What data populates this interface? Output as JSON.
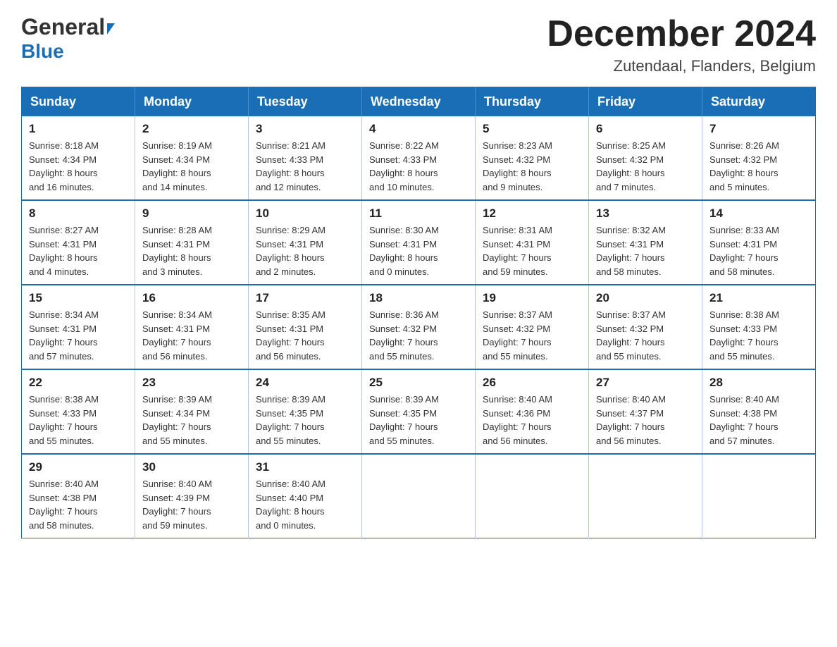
{
  "header": {
    "logo_general": "General",
    "logo_blue": "Blue",
    "month_title": "December 2024",
    "location": "Zutendaal, Flanders, Belgium"
  },
  "weekdays": [
    "Sunday",
    "Monday",
    "Tuesday",
    "Wednesday",
    "Thursday",
    "Friday",
    "Saturday"
  ],
  "weeks": [
    [
      {
        "day": "1",
        "sunrise": "8:18 AM",
        "sunset": "4:34 PM",
        "daylight": "8 hours and 16 minutes."
      },
      {
        "day": "2",
        "sunrise": "8:19 AM",
        "sunset": "4:34 PM",
        "daylight": "8 hours and 14 minutes."
      },
      {
        "day": "3",
        "sunrise": "8:21 AM",
        "sunset": "4:33 PM",
        "daylight": "8 hours and 12 minutes."
      },
      {
        "day": "4",
        "sunrise": "8:22 AM",
        "sunset": "4:33 PM",
        "daylight": "8 hours and 10 minutes."
      },
      {
        "day": "5",
        "sunrise": "8:23 AM",
        "sunset": "4:32 PM",
        "daylight": "8 hours and 9 minutes."
      },
      {
        "day": "6",
        "sunrise": "8:25 AM",
        "sunset": "4:32 PM",
        "daylight": "8 hours and 7 minutes."
      },
      {
        "day": "7",
        "sunrise": "8:26 AM",
        "sunset": "4:32 PM",
        "daylight": "8 hours and 5 minutes."
      }
    ],
    [
      {
        "day": "8",
        "sunrise": "8:27 AM",
        "sunset": "4:31 PM",
        "daylight": "8 hours and 4 minutes."
      },
      {
        "day": "9",
        "sunrise": "8:28 AM",
        "sunset": "4:31 PM",
        "daylight": "8 hours and 3 minutes."
      },
      {
        "day": "10",
        "sunrise": "8:29 AM",
        "sunset": "4:31 PM",
        "daylight": "8 hours and 2 minutes."
      },
      {
        "day": "11",
        "sunrise": "8:30 AM",
        "sunset": "4:31 PM",
        "daylight": "8 hours and 0 minutes."
      },
      {
        "day": "12",
        "sunrise": "8:31 AM",
        "sunset": "4:31 PM",
        "daylight": "7 hours and 59 minutes."
      },
      {
        "day": "13",
        "sunrise": "8:32 AM",
        "sunset": "4:31 PM",
        "daylight": "7 hours and 58 minutes."
      },
      {
        "day": "14",
        "sunrise": "8:33 AM",
        "sunset": "4:31 PM",
        "daylight": "7 hours and 58 minutes."
      }
    ],
    [
      {
        "day": "15",
        "sunrise": "8:34 AM",
        "sunset": "4:31 PM",
        "daylight": "7 hours and 57 minutes."
      },
      {
        "day": "16",
        "sunrise": "8:34 AM",
        "sunset": "4:31 PM",
        "daylight": "7 hours and 56 minutes."
      },
      {
        "day": "17",
        "sunrise": "8:35 AM",
        "sunset": "4:31 PM",
        "daylight": "7 hours and 56 minutes."
      },
      {
        "day": "18",
        "sunrise": "8:36 AM",
        "sunset": "4:32 PM",
        "daylight": "7 hours and 55 minutes."
      },
      {
        "day": "19",
        "sunrise": "8:37 AM",
        "sunset": "4:32 PM",
        "daylight": "7 hours and 55 minutes."
      },
      {
        "day": "20",
        "sunrise": "8:37 AM",
        "sunset": "4:32 PM",
        "daylight": "7 hours and 55 minutes."
      },
      {
        "day": "21",
        "sunrise": "8:38 AM",
        "sunset": "4:33 PM",
        "daylight": "7 hours and 55 minutes."
      }
    ],
    [
      {
        "day": "22",
        "sunrise": "8:38 AM",
        "sunset": "4:33 PM",
        "daylight": "7 hours and 55 minutes."
      },
      {
        "day": "23",
        "sunrise": "8:39 AM",
        "sunset": "4:34 PM",
        "daylight": "7 hours and 55 minutes."
      },
      {
        "day": "24",
        "sunrise": "8:39 AM",
        "sunset": "4:35 PM",
        "daylight": "7 hours and 55 minutes."
      },
      {
        "day": "25",
        "sunrise": "8:39 AM",
        "sunset": "4:35 PM",
        "daylight": "7 hours and 55 minutes."
      },
      {
        "day": "26",
        "sunrise": "8:40 AM",
        "sunset": "4:36 PM",
        "daylight": "7 hours and 56 minutes."
      },
      {
        "day": "27",
        "sunrise": "8:40 AM",
        "sunset": "4:37 PM",
        "daylight": "7 hours and 56 minutes."
      },
      {
        "day": "28",
        "sunrise": "8:40 AM",
        "sunset": "4:38 PM",
        "daylight": "7 hours and 57 minutes."
      }
    ],
    [
      {
        "day": "29",
        "sunrise": "8:40 AM",
        "sunset": "4:38 PM",
        "daylight": "7 hours and 58 minutes."
      },
      {
        "day": "30",
        "sunrise": "8:40 AM",
        "sunset": "4:39 PM",
        "daylight": "7 hours and 59 minutes."
      },
      {
        "day": "31",
        "sunrise": "8:40 AM",
        "sunset": "4:40 PM",
        "daylight": "8 hours and 0 minutes."
      },
      null,
      null,
      null,
      null
    ]
  ],
  "labels": {
    "sunrise": "Sunrise:",
    "sunset": "Sunset:",
    "daylight": "Daylight:"
  }
}
